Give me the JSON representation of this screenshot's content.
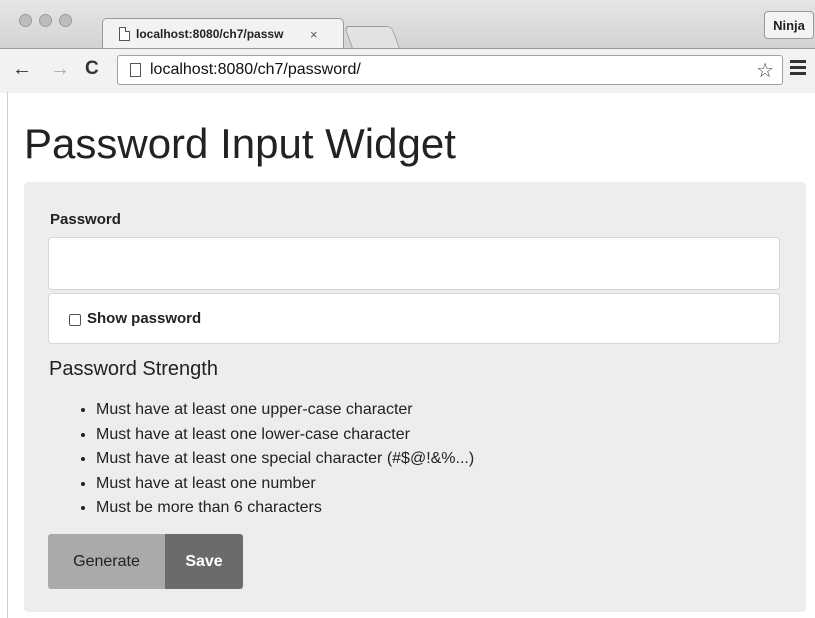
{
  "browser": {
    "tab_title": "localhost:8080/ch7/passw",
    "tab_close": "×",
    "profile_label": "Ninja",
    "url": "localhost:8080/ch7/password/",
    "nav": {
      "back": "←",
      "forward": "→",
      "reload": "C"
    },
    "star": "☆"
  },
  "page": {
    "title": "Password Input Widget",
    "password_label": "Password",
    "password_value": "",
    "show_password_label": "Show password",
    "show_password_checked": false,
    "strength_title": "Password Strength",
    "requirements": [
      "Must have at least one upper-case character",
      "Must have at least one lower-case character",
      "Must have at least one special character (#$@!&%...)",
      "Must have at least one number",
      "Must be more than 6 characters"
    ],
    "buttons": {
      "generate": "Generate",
      "save": "Save"
    }
  },
  "colors": {
    "panel_bg": "#ededed",
    "generate_bg": "#aaaaaa",
    "save_bg": "#6b6b6b"
  }
}
